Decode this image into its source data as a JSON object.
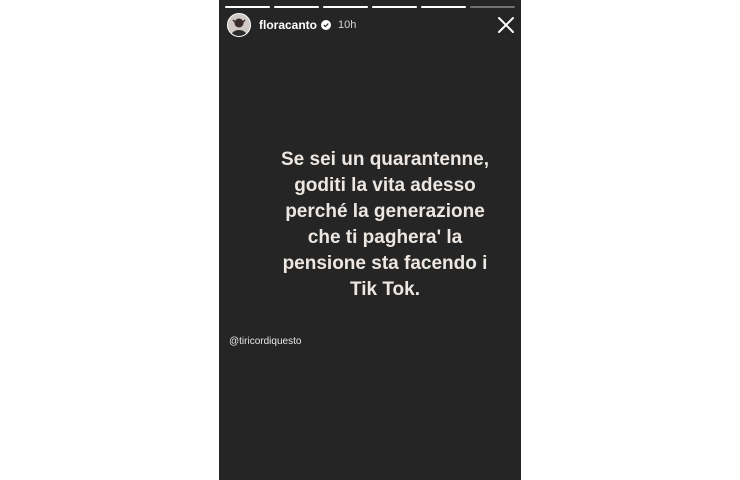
{
  "story": {
    "progress": [
      1,
      1,
      1,
      1,
      1,
      0
    ],
    "username": "floracanto",
    "verified": true,
    "time": "10h",
    "text": "Se sei un quarantenne,\ngoditi la vita adesso\nperché la generazione\nche ti paghera' la\npensione sta facendo i\nTik Tok.",
    "mention": "@tiricordiquesto",
    "background_color": "#252525",
    "text_color": "#ece7e2"
  },
  "icons": {
    "avatar": "profile-photo",
    "verified": "verified-badge-icon",
    "close": "close-icon"
  }
}
